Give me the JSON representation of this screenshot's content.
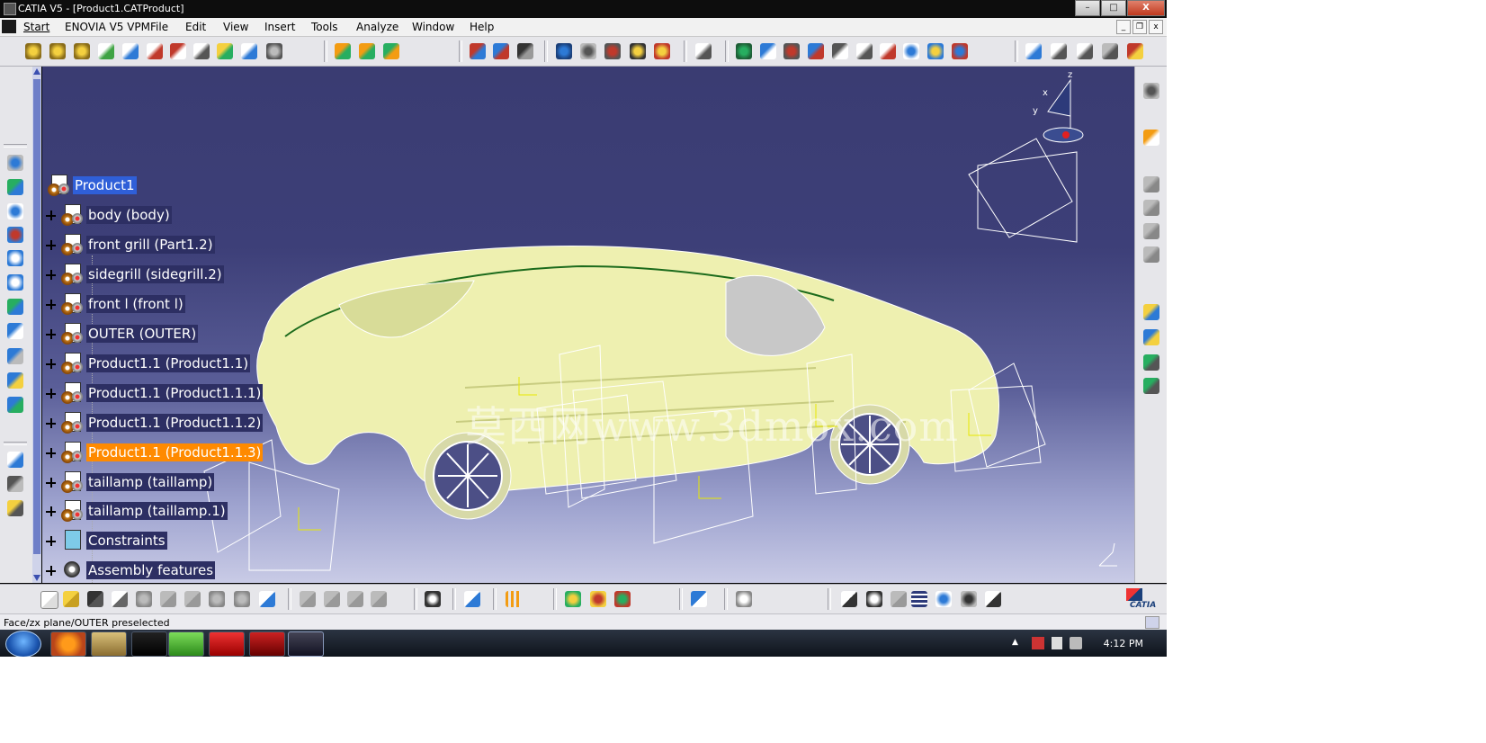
{
  "window": {
    "title": "CATIA V5 - [Product1.CATProduct]",
    "minimize": "–",
    "maximize": "□",
    "close": "X"
  },
  "menubar": {
    "items": [
      "Start",
      "ENOVIA V5 VPM",
      "File",
      "Edit",
      "View",
      "Insert",
      "Tools",
      "Analyze",
      "Window",
      "Help"
    ]
  },
  "tree": {
    "root": "Product1",
    "nodes": [
      {
        "label": "body (body)",
        "state": "normal"
      },
      {
        "label": "front grill (Part1.2)",
        "state": "normal"
      },
      {
        "label": "sidegrill (sidegrill.2)",
        "state": "normal"
      },
      {
        "label": "front l (front l)",
        "state": "normal"
      },
      {
        "label": "OUTER (OUTER)",
        "state": "normal"
      },
      {
        "label": "Product1.1 (Product1.1)",
        "state": "normal"
      },
      {
        "label": "Product1.1 (Product1.1.1)",
        "state": "normal"
      },
      {
        "label": "Product1.1 (Product1.1.2)",
        "state": "normal"
      },
      {
        "label": "Product1.1 (Product1.1.3)",
        "state": "preselected"
      },
      {
        "label": "taillamp (taillamp)",
        "state": "normal"
      },
      {
        "label": "taillamp (taillamp.1)",
        "state": "normal"
      },
      {
        "label": "Constraints",
        "state": "normal"
      },
      {
        "label": "Assembly features",
        "state": "normal"
      }
    ]
  },
  "watermark": "莫西网www.3dmox.com",
  "compass": {
    "x": "x",
    "y": "y",
    "z": "z"
  },
  "status": {
    "text": "Face/zx plane/OUTER preselected"
  },
  "taskbar": {
    "clock": "4:12 PM"
  },
  "brand": "CATIA",
  "colors": {
    "viewport_top": "#3a3c72",
    "car_body": "#eef0b0",
    "selected": "#2f5fd8",
    "preselected": "#ff8a00"
  }
}
